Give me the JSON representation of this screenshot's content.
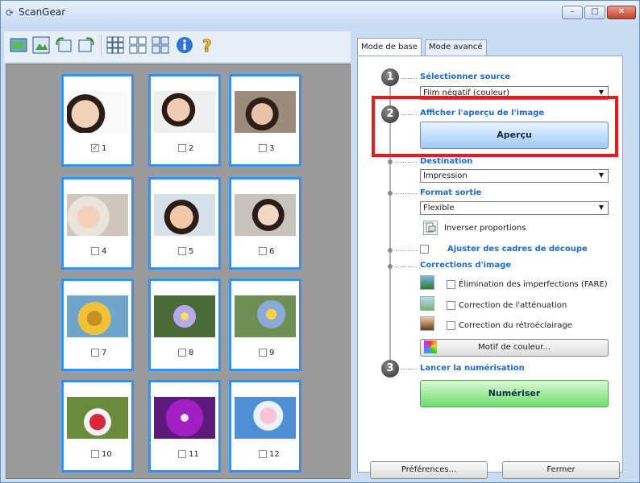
{
  "window": {
    "title": "ScanGear"
  },
  "window_controls": {
    "minimize": "–",
    "maximize": "□",
    "close": "✕"
  },
  "toolbar": {
    "items": [
      "thumbnail-view-icon",
      "whole-image-icon",
      "rotate-left-icon",
      "rotate-right-icon",
      "layout-grid-small-icon",
      "layout-grid-medium-icon",
      "layout-grid-large-icon",
      "info-icon",
      "help-icon"
    ]
  },
  "thumbnails": [
    {
      "number": "1",
      "checked": true,
      "checkmark": "✓"
    },
    {
      "number": "2",
      "checked": false
    },
    {
      "number": "3",
      "checked": false
    },
    {
      "number": "4",
      "checked": false
    },
    {
      "number": "5",
      "checked": false
    },
    {
      "number": "6",
      "checked": false
    },
    {
      "number": "7",
      "checked": false
    },
    {
      "number": "8",
      "checked": false
    },
    {
      "number": "9",
      "checked": false
    },
    {
      "number": "10",
      "checked": false
    },
    {
      "number": "11",
      "checked": false
    },
    {
      "number": "12",
      "checked": false
    }
  ],
  "tabs": [
    "Mode de base",
    "Mode avancé"
  ],
  "steps": {
    "one": {
      "num": "1",
      "label": "Sélectionner source",
      "select_value": "Film négatif (couleur)"
    },
    "two": {
      "num": "2",
      "label": "Afficher l'aperçu de l'image",
      "button": "Aperçu"
    },
    "destination": {
      "label": "Destination",
      "value": "Impression"
    },
    "format": {
      "label": "Format sortie",
      "value": "Flexible",
      "invert": "Inverser proportions"
    },
    "crop": {
      "label": "Ajuster des cadres de découpe"
    },
    "corrections": {
      "label": "Corrections d'image",
      "items": [
        "Élimination des imperfections (FARE)",
        "Correction de l'atténuation",
        "Correction du rétroéclairage"
      ],
      "color_button": "Motif de couleur..."
    },
    "three": {
      "num": "3",
      "label": "Lancer la numérisation",
      "button": "Numériser"
    }
  },
  "footer": {
    "preferences": "Préférences...",
    "close": "Fermer"
  },
  "colors": {
    "accent_blue": "#1d6bd3",
    "highlight_red": "#e41c1c",
    "thumb_border": "#3e8fe4"
  }
}
